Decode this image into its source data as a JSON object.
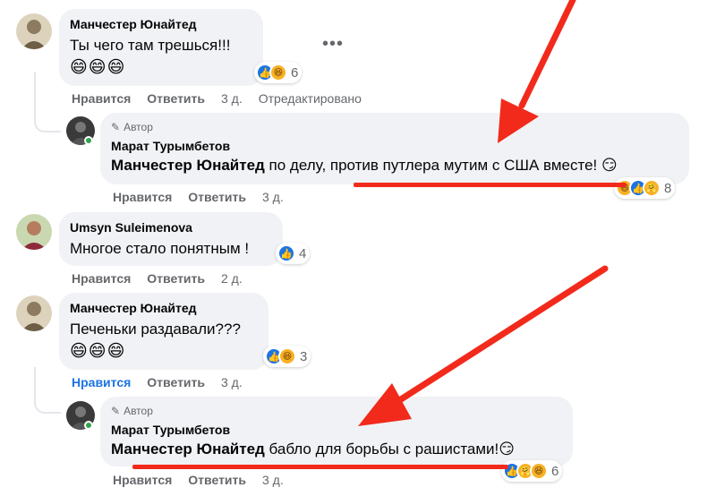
{
  "comments": [
    {
      "author": "Манчестер Юнайтед",
      "text": "Ты чего там трешься!!!",
      "emojis": "😄😄😄",
      "more": "•••",
      "reactions": {
        "count": "6",
        "icons": [
          "like",
          "haha"
        ]
      },
      "actions": {
        "like": "Нравится",
        "reply": "Ответить",
        "time": "3 д.",
        "edited": "Отредактировано"
      }
    },
    {
      "author_badge": "Автор",
      "author": "Марат Турымбетов",
      "mention": "Манчестер Юнайтед",
      "text": " по делу, против путлера мутим с США вместе! 😏",
      "reactions": {
        "count": "8",
        "icons": [
          "haha",
          "like",
          "care"
        ]
      },
      "actions": {
        "like": "Нравится",
        "reply": "Ответить",
        "time": "3 д."
      }
    },
    {
      "author": "Umsyn Suleimenova",
      "text": "Многое стало понятным !",
      "reactions": {
        "count": "4",
        "icons": [
          "like"
        ]
      },
      "actions": {
        "like": "Нравится",
        "reply": "Ответить",
        "time": "2 д."
      }
    },
    {
      "author": "Манчестер Юнайтед",
      "text": "Печеньки раздавали???",
      "emojis": "😄😄😄",
      "reactions": {
        "count": "3",
        "icons": [
          "like",
          "haha"
        ]
      },
      "actions": {
        "like": "Нравится",
        "reply": "Ответить",
        "time": "3 д."
      }
    },
    {
      "author_badge": "Автор",
      "author": "Марат Турымбетов",
      "mention": "Манчестер Юнайтед",
      "text": " бабло для борьбы с рашистами!😏",
      "reactions": {
        "count": "6",
        "icons": [
          "like",
          "care",
          "haha"
        ]
      },
      "actions": {
        "like": "Нравится",
        "reply": "Ответить",
        "time": "3 д."
      }
    }
  ],
  "colors": {
    "bubble": "#f0f2f5",
    "action_text": "#65676b",
    "liked": "#1b74e4",
    "annotation_red": "#f22a1b",
    "online": "#31a24c"
  }
}
